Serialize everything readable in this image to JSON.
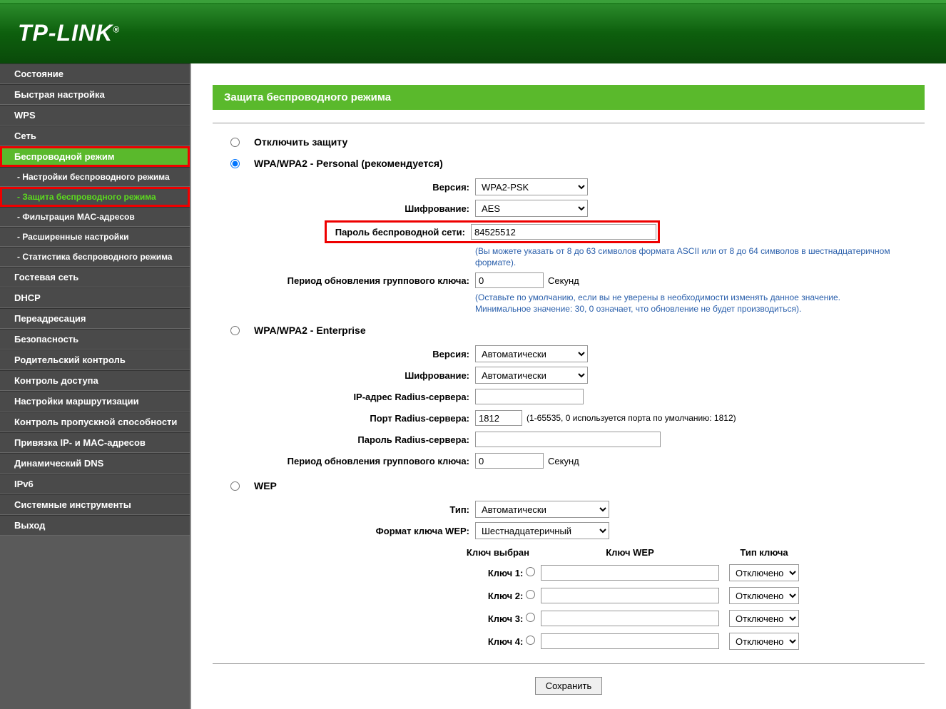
{
  "logo": "TP-LINK",
  "menu": [
    "Состояние",
    "Быстрая настройка",
    "WPS",
    "Сеть",
    "Беспроводной режим",
    "- Настройки беспроводного режима",
    "- Защита беспроводного режима",
    "- Фильтрация MAC-адресов",
    "- Расширенные настройки",
    "- Статистика беспроводного режима",
    "Гостевая сеть",
    "DHCP",
    "Переадресация",
    "Безопасность",
    "Родительский контроль",
    "Контроль доступа",
    "Настройки маршрутизации",
    "Контроль пропускной способности",
    "Привязка IP- и MAC-адресов",
    "Динамический DNS",
    "IPv6",
    "Системные инструменты",
    "Выход"
  ],
  "pageTitle": "Защита беспроводного режима",
  "disable": {
    "label": "Отключить защиту"
  },
  "personal": {
    "title": "WPA/WPA2 - Personal (рекомендуется)",
    "version_label": "Версия:",
    "version_value": "WPA2-PSK",
    "encryption_label": "Шифрование:",
    "encryption_value": "AES",
    "password_label": "Пароль беспроводной сети:",
    "password_value": "84525512",
    "password_note": "(Вы можете указать от 8 до 63 символов формата ASCII или от 8 до 64 символов в шестнадцатеричном формате).",
    "group_key_label": "Период обновления группового ключа:",
    "group_key_value": "0",
    "seconds": "Секунд",
    "group_key_note": "(Оставьте по умолчанию, если вы не уверены в необходимости изменять данное значение. Минимальное значение: 30, 0 означает, что обновление не будет производиться)."
  },
  "enterprise": {
    "title": "WPA/WPA2 - Enterprise",
    "version_label": "Версия:",
    "version_value": "Автоматически",
    "encryption_label": "Шифрование:",
    "encryption_value": "Автоматически",
    "radius_ip_label": "IP-адрес Radius-сервера:",
    "radius_ip_value": "",
    "radius_port_label": "Порт Radius-сервера:",
    "radius_port_value": "1812",
    "radius_port_note": "(1-65535, 0 используется порта по умолчанию: 1812)",
    "radius_pass_label": "Пароль Radius-сервера:",
    "radius_pass_value": "",
    "group_key_label": "Период обновления группового ключа:",
    "group_key_value": "0",
    "seconds": "Секунд"
  },
  "wep": {
    "title": "WEP",
    "type_label": "Тип:",
    "type_value": "Автоматически",
    "format_label": "Формат ключа WEP:",
    "format_value": "Шестнадцатеричный",
    "col_selected": "Ключ выбран",
    "col_key": "Ключ WEP",
    "col_type": "Тип ключа",
    "keys": [
      {
        "label": "Ключ 1:",
        "value": "",
        "type": "Отключено"
      },
      {
        "label": "Ключ 2:",
        "value": "",
        "type": "Отключено"
      },
      {
        "label": "Ключ 3:",
        "value": "",
        "type": "Отключено"
      },
      {
        "label": "Ключ 4:",
        "value": "",
        "type": "Отключено"
      }
    ]
  },
  "save": "Сохранить"
}
